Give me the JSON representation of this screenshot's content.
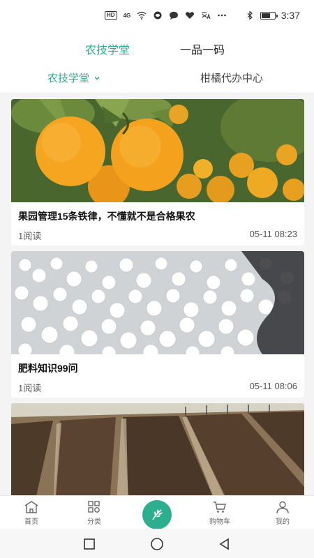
{
  "status_bar": {
    "hd": "HD",
    "signal": "4G",
    "time": "3:37"
  },
  "top_tabs": [
    {
      "label": "农技学堂",
      "active": true
    },
    {
      "label": "一品一码",
      "active": false
    }
  ],
  "sub_nav": {
    "left": {
      "label": "农技学堂",
      "icon": "chevron-down-icon"
    },
    "right": {
      "label": "柑橘代办中心"
    }
  },
  "articles": [
    {
      "title": "果园管理15条铁律，不懂就不是合格果农",
      "reads": "1阅读",
      "time": "05-11 08:23",
      "image": "oranges-on-tree"
    },
    {
      "title": "肥料知识99问",
      "reads": "1阅读",
      "time": "05-11 08:06",
      "image": "white-fertilizer-granules"
    },
    {
      "title": "",
      "reads": "",
      "time": "",
      "image": "tilled-soil-field"
    }
  ],
  "bottom_nav": [
    {
      "label": "首页",
      "icon": "home-icon"
    },
    {
      "label": "分类",
      "icon": "grid-icon"
    },
    {
      "label": "",
      "icon": "leaf-icon"
    },
    {
      "label": "购物车",
      "icon": "cart-icon"
    },
    {
      "label": "我的",
      "icon": "user-icon"
    }
  ],
  "colors": {
    "accent": "#2cae8f",
    "background": "#f4f4f4"
  }
}
